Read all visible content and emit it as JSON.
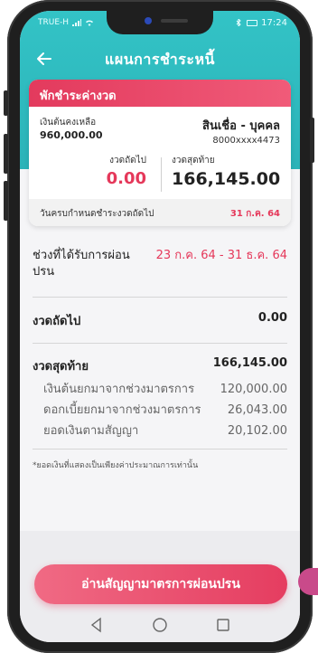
{
  "status_bar": {
    "carrier": "TRUE-H",
    "time": "17:24"
  },
  "header": {
    "title": "แผนการชำระหนี้"
  },
  "card": {
    "heading": "พักชำระค่างวด",
    "principal_label": "เงินต้นคงเหลือ",
    "principal_value": "960,000.00",
    "loan_type": "สินเชื่อ - บุคคล",
    "account_no": "8000xxxx4473",
    "next_label": "งวดถัดไป",
    "next_value": "0.00",
    "last_label": "งวดสุดท้าย",
    "last_value": "166,145.00",
    "due_label": "วันครบกำหนดชำระงวดถัดไป",
    "due_date": "31 ก.ค. 64"
  },
  "relief": {
    "label_line1": "ช่วงที่ได้รับการผ่อน",
    "label_line2": "ปรน",
    "period": "23 ก.ค. 64 - 31 ธ.ค. 64"
  },
  "summary": {
    "next_label": "งวดถัดไป",
    "next_value": "0.00",
    "last_label": "งวดสุดท้าย",
    "last_value": "166,145.00",
    "items": [
      {
        "label": "เงินต้นยกมาจากช่วงมาตรการ",
        "value": "120,000.00"
      },
      {
        "label": "ดอกเบี้ยยกมาจากช่วงมาตรการ",
        "value": "26,043.00"
      },
      {
        "label": "ยอดเงินตามสัญญา",
        "value": "20,102.00"
      }
    ]
  },
  "note": "*ยอดเงินที่แสดงเป็นเพียงค่าประมาณการเท่านั้น",
  "cta": {
    "label": "อ่านสัญญามาตรการผ่อนปรน"
  },
  "colors": {
    "teal": "#2bb3b8",
    "accent": "#e5385a",
    "card_header": "#e33a5d"
  }
}
